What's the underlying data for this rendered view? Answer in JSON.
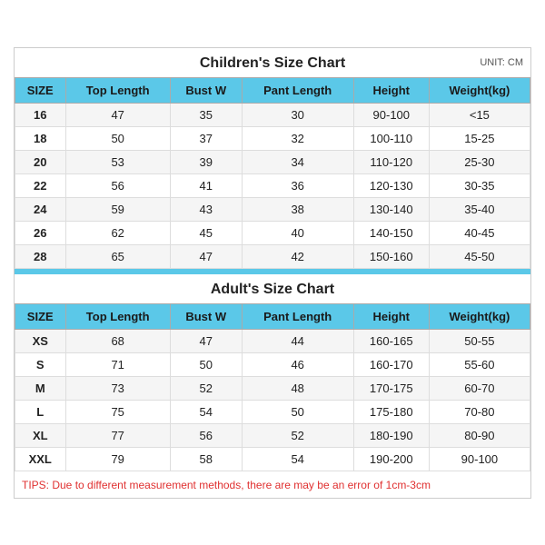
{
  "children_chart": {
    "title": "Children's Size Chart",
    "unit": "UNIT: CM",
    "headers": [
      "SIZE",
      "Top Length",
      "Bust W",
      "Pant Length",
      "Height",
      "Weight(kg)"
    ],
    "rows": [
      [
        "16",
        "47",
        "35",
        "30",
        "90-100",
        "<15"
      ],
      [
        "18",
        "50",
        "37",
        "32",
        "100-110",
        "15-25"
      ],
      [
        "20",
        "53",
        "39",
        "34",
        "110-120",
        "25-30"
      ],
      [
        "22",
        "56",
        "41",
        "36",
        "120-130",
        "30-35"
      ],
      [
        "24",
        "59",
        "43",
        "38",
        "130-140",
        "35-40"
      ],
      [
        "26",
        "62",
        "45",
        "40",
        "140-150",
        "40-45"
      ],
      [
        "28",
        "65",
        "47",
        "42",
        "150-160",
        "45-50"
      ]
    ]
  },
  "adults_chart": {
    "title": "Adult's Size Chart",
    "headers": [
      "SIZE",
      "Top Length",
      "Bust W",
      "Pant Length",
      "Height",
      "Weight(kg)"
    ],
    "rows": [
      [
        "XS",
        "68",
        "47",
        "44",
        "160-165",
        "50-55"
      ],
      [
        "S",
        "71",
        "50",
        "46",
        "160-170",
        "55-60"
      ],
      [
        "M",
        "73",
        "52",
        "48",
        "170-175",
        "60-70"
      ],
      [
        "L",
        "75",
        "54",
        "50",
        "175-180",
        "70-80"
      ],
      [
        "XL",
        "77",
        "56",
        "52",
        "180-190",
        "80-90"
      ],
      [
        "XXL",
        "79",
        "58",
        "54",
        "190-200",
        "90-100"
      ]
    ]
  },
  "tips": "TIPS: Due to different measurement methods, there are may be an error of 1cm-3cm"
}
